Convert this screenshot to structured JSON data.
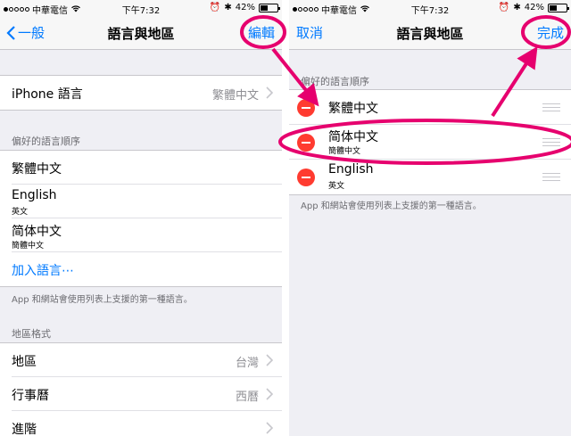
{
  "status_bar": {
    "carrier": "中華電信",
    "time": "下午7:32",
    "battery": "42%",
    "battery_level": 0.42
  },
  "left": {
    "nav": {
      "back_label": "一般",
      "title": "語言與地區",
      "edit_label": "編輯"
    },
    "iphone_language": {
      "label": "iPhone 語言",
      "value": "繁體中文"
    },
    "preferred_header": "偏好的語言順序",
    "languages": [
      {
        "name": "繁體中文",
        "native": ""
      },
      {
        "name": "English",
        "native": "英文"
      },
      {
        "name": "简体中文",
        "native": "簡體中文"
      }
    ],
    "add_language": "加入語言⋯",
    "note": "App 和網站會使用列表上支援的第一種語言。",
    "region_header": "地區格式",
    "region_rows": [
      {
        "label": "地區",
        "value": "台灣"
      },
      {
        "label": "行事曆",
        "value": "西曆"
      },
      {
        "label": "進階",
        "value": ""
      }
    ]
  },
  "right": {
    "nav": {
      "cancel_label": "取消",
      "title": "語言與地區",
      "done_label": "完成"
    },
    "preferred_header": "偏好的語言順序",
    "languages": [
      {
        "name": "繁體中文",
        "native": ""
      },
      {
        "name": "简体中文",
        "native": "簡體中文"
      },
      {
        "name": "English",
        "native": "英文"
      }
    ],
    "note": "App 和網站會使用列表上支援的第一種語言。"
  },
  "colors": {
    "accent": "#007aff",
    "delete": "#ff3b30",
    "annotation": "#e6006e",
    "background": "#efeff4"
  }
}
